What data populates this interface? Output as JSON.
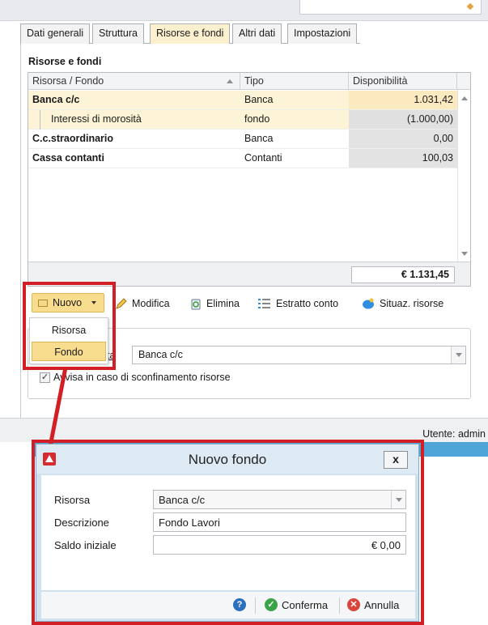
{
  "tabs": [
    {
      "label": "Dati generali"
    },
    {
      "label": "Struttura"
    },
    {
      "label": "Risorse e fondi"
    },
    {
      "label": "Altri dati"
    },
    {
      "label": "Impostazioni"
    }
  ],
  "section_title": "Risorse e fondi",
  "grid": {
    "columns": [
      "Risorsa / Fondo",
      "Tipo",
      "Disponibilità"
    ],
    "rows": [
      {
        "name": "Banca c/c",
        "type": "Banca",
        "amount": "1.031,42"
      },
      {
        "name": "Interessi di morosità",
        "type": "fondo",
        "amount": "(1.000,00)"
      },
      {
        "name": "C.c.straordinario",
        "type": "Banca",
        "amount": "0,00"
      },
      {
        "name": "Cassa contanti",
        "type": "Contanti",
        "amount": "100,03"
      }
    ],
    "total": "€ 1.131,45"
  },
  "toolbar": {
    "nuovo": "Nuovo",
    "modifica": "Modifica",
    "elimina": "Elimina",
    "estratto": "Estratto conto",
    "situaz": "Situaz. risorse"
  },
  "menu": {
    "items": [
      "Risorsa",
      "Fondo"
    ]
  },
  "lower": {
    "risorsa_label": "ta",
    "risorsa_value": "Banca c/c",
    "checkbox_label": "Avvisa in caso di sconfinamento risorse",
    "checkbox_checked": true
  },
  "status": {
    "user": "Utente: admin"
  },
  "dialog": {
    "title": "Nuovo fondo",
    "close": "x",
    "fields": {
      "risorsa_label": "Risorsa",
      "risorsa_value": "Banca c/c",
      "descrizione_label": "Descrizione",
      "descrizione_value": "Fondo Lavori",
      "saldo_label": "Saldo iniziale",
      "saldo_value": "€ 0,00"
    },
    "buttons": {
      "help": "?",
      "conferma": "Conferma",
      "annulla": "Annulla"
    }
  },
  "colors": {
    "highlight_red": "#d21f26",
    "selection_yellow": "#fdf3d6",
    "button_yellow": "#f9dd8f",
    "title_blue": "#dde9f3"
  }
}
